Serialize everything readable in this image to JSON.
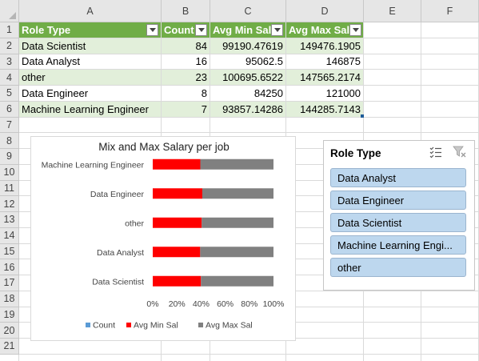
{
  "sheet": {
    "columns": [
      "A",
      "B",
      "C",
      "D",
      "E",
      "F"
    ],
    "rows": [
      "1",
      "2",
      "3",
      "4",
      "5",
      "6",
      "7",
      "8",
      "9",
      "10",
      "11",
      "12",
      "13",
      "14",
      "15",
      "16",
      "17",
      "18",
      "19",
      "20",
      "21"
    ]
  },
  "table": {
    "headers": [
      "Role Type",
      "Count",
      "Avg Min Sal",
      "Avg Max Sal"
    ],
    "rows": [
      [
        "Data Scientist",
        "84",
        "99190.47619",
        "149476.1905"
      ],
      [
        "Data Analyst",
        "16",
        "95062.5",
        "146875"
      ],
      [
        "other",
        "23",
        "100695.6522",
        "147565.2174"
      ],
      [
        "Data Engineer",
        "8",
        "84250",
        "121000"
      ],
      [
        "Machine Learning Engineer",
        "7",
        "93857.14286",
        "144285.7143"
      ]
    ],
    "header_color": "#70ad47",
    "band_color": "#e2efda"
  },
  "chart_data": {
    "type": "bar",
    "orientation": "horizontal",
    "stacking": "percent",
    "title": "Mix and Max Salary per job",
    "categories": [
      "Data Scientist",
      "Data Analyst",
      "other",
      "Data Engineer",
      "Machine Learning Engineer"
    ],
    "series": [
      {
        "name": "Count",
        "color": "#5b9bd5",
        "values": [
          84,
          16,
          23,
          8,
          7
        ]
      },
      {
        "name": "Avg Min Sal",
        "color": "#ff0000",
        "values": [
          99190.47619,
          95062.5,
          100695.6522,
          84250,
          93857.14286
        ]
      },
      {
        "name": "Avg Max Sal",
        "color": "#808080",
        "values": [
          149476.1905,
          146875,
          147565.2174,
          121000,
          144285.7143
        ]
      }
    ],
    "x_ticks": [
      "0%",
      "20%",
      "40%",
      "60%",
      "80%",
      "100%"
    ],
    "xlim": [
      0,
      1
    ],
    "legend": "bottom",
    "grid": false
  },
  "slicer": {
    "title": "Role Type",
    "icons": [
      "multi-select-icon",
      "clear-filter-icon"
    ],
    "items": [
      "Data Analyst",
      "Data Engineer",
      "Data Scientist",
      "Machine Learning Engi...",
      "other"
    ],
    "item_color": "#bdd7ee"
  }
}
